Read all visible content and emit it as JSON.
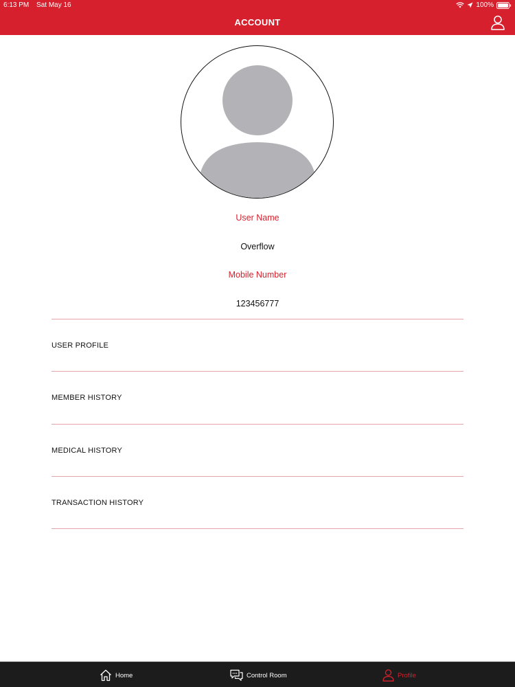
{
  "status_bar": {
    "time": "6:13 PM",
    "date": "Sat May 16",
    "battery": "100%"
  },
  "header": {
    "title": "ACCOUNT",
    "account_icon": "person-outline-icon"
  },
  "profile": {
    "avatar_icon": "default-avatar-icon",
    "user_name_label": "User Name",
    "user_name_value": "Overflow",
    "mobile_label": "Mobile Number",
    "mobile_value": "123456777"
  },
  "menu": {
    "items": [
      {
        "label": "USER PROFILE"
      },
      {
        "label": "MEMBER HISTORY"
      },
      {
        "label": "MEDICAL HISTORY"
      },
      {
        "label": "TRANSACTION HISTORY"
      }
    ]
  },
  "tabbar": {
    "tabs": [
      {
        "label": "Home",
        "icon": "home-icon"
      },
      {
        "label": "Control Room",
        "icon": "chat-icon"
      },
      {
        "label": "Profile",
        "icon": "person-icon",
        "active": true
      }
    ]
  },
  "colors": {
    "brand_red": "#d7202d",
    "divider": "#e8a4ab",
    "tabbar_bg": "#1c1c1c",
    "avatar_gray": "#b3b2b6"
  }
}
